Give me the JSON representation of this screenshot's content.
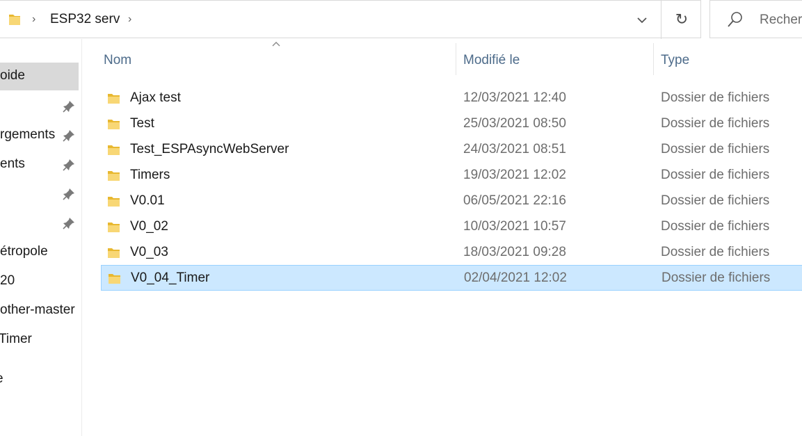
{
  "address_bar": {
    "breadcrumb": "ESP32 serv",
    "search_placeholder": "Rechercher"
  },
  "nav": {
    "items": [
      {
        "label": "oide",
        "selected": true,
        "pinned": false
      },
      {
        "label": "",
        "selected": false,
        "pinned": true
      },
      {
        "label": "rgements",
        "selected": false,
        "pinned": true
      },
      {
        "label": "ents",
        "selected": false,
        "pinned": true
      },
      {
        "label": "",
        "selected": false,
        "pinned": true
      },
      {
        "label": "",
        "selected": false,
        "pinned": true
      },
      {
        "label": "étropole",
        "selected": false,
        "pinned": false
      },
      {
        "label": "20",
        "selected": false,
        "pinned": false
      },
      {
        "label": "other-master",
        "selected": false,
        "pinned": false
      },
      {
        "label": "Timer",
        "selected": false,
        "pinned": false
      },
      {
        "label": "e",
        "selected": false,
        "pinned": false
      }
    ]
  },
  "columns": {
    "name": "Nom",
    "modified": "Modifié le",
    "type": "Type"
  },
  "files": [
    {
      "name": "Ajax test",
      "modified": "12/03/2021 12:40",
      "type": "Dossier de fichiers",
      "selected": false
    },
    {
      "name": "Test",
      "modified": "25/03/2021 08:50",
      "type": "Dossier de fichiers",
      "selected": false
    },
    {
      "name": "Test_ESPAsyncWebServer",
      "modified": "24/03/2021 08:51",
      "type": "Dossier de fichiers",
      "selected": false
    },
    {
      "name": "Timers",
      "modified": "19/03/2021 12:02",
      "type": "Dossier de fichiers",
      "selected": false
    },
    {
      "name": "V0.01",
      "modified": "06/05/2021 22:16",
      "type": "Dossier de fichiers",
      "selected": false
    },
    {
      "name": "V0_02",
      "modified": "10/03/2021 10:57",
      "type": "Dossier de fichiers",
      "selected": false
    },
    {
      "name": "V0_03",
      "modified": "18/03/2021 09:28",
      "type": "Dossier de fichiers",
      "selected": false
    },
    {
      "name": "V0_04_Timer",
      "modified": "02/04/2021 12:02",
      "type": "Dossier de fichiers",
      "selected": true
    }
  ],
  "colors": {
    "selection_bg": "#cce8ff",
    "selection_border": "#99d1ff",
    "nav_selected_bg": "#d9d9d9",
    "header_text": "#4d6b8a",
    "folder_yellow": "#f8d775"
  }
}
